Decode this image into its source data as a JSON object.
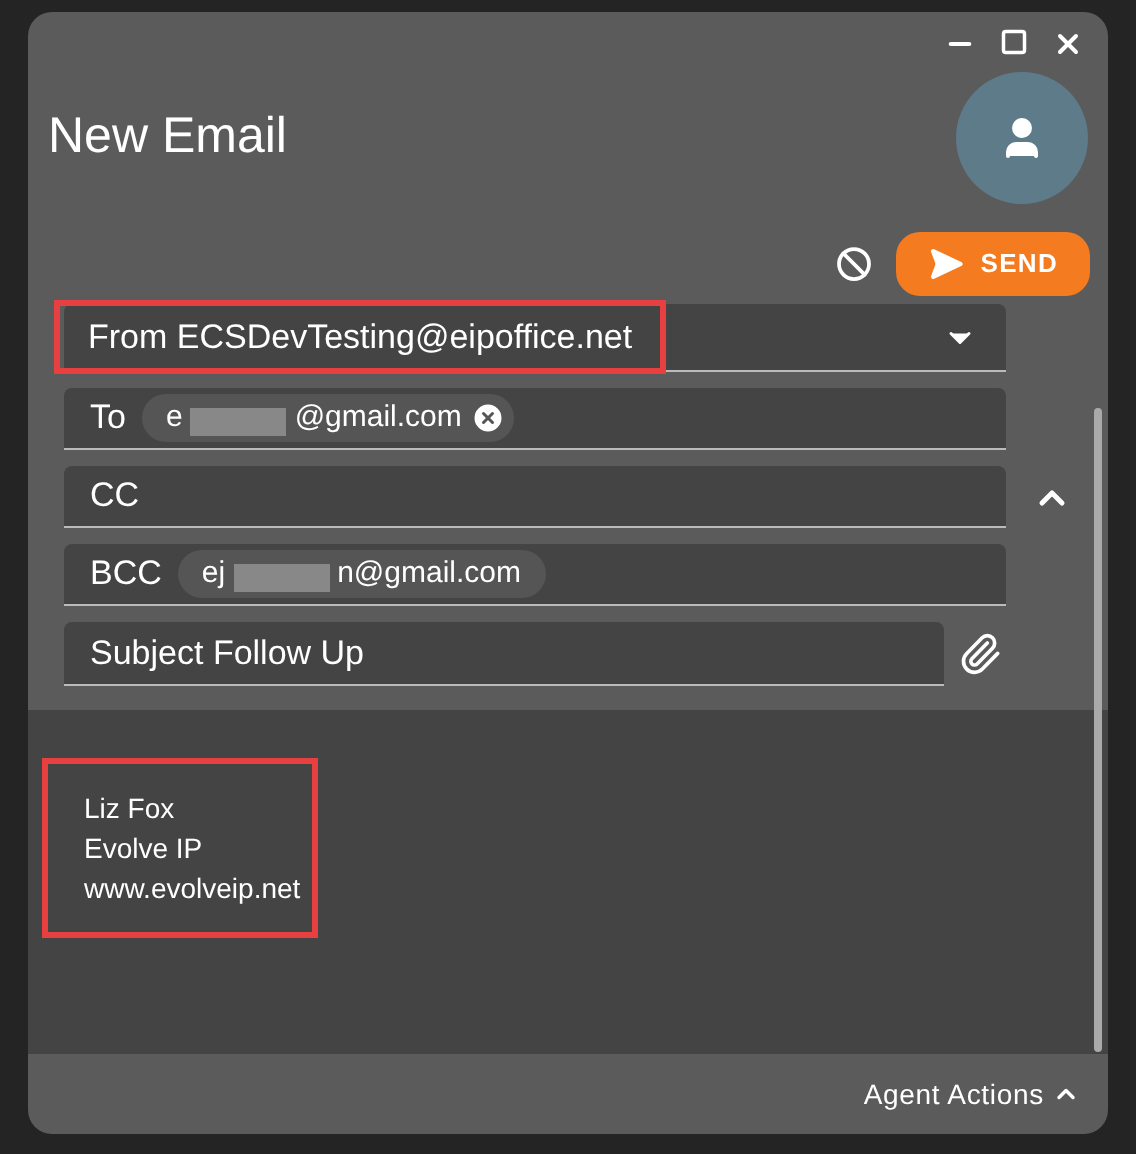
{
  "window": {
    "title": "New Email"
  },
  "actions": {
    "send": "SEND"
  },
  "from": {
    "label": "From",
    "value": "ECSDevTesting@eipoffice.net",
    "highlighted": true
  },
  "to": {
    "label": "To",
    "chips": [
      {
        "prefix": "e",
        "suffix": "@gmail.com",
        "removable": true
      }
    ]
  },
  "cc": {
    "label": "CC",
    "expanded": true
  },
  "bcc": {
    "label": "BCC",
    "chips": [
      {
        "prefix": "ej",
        "suffix": "n@gmail.com",
        "removable": false
      }
    ]
  },
  "subject": {
    "label": "Subject",
    "value": "Follow Up"
  },
  "signature": {
    "lines": [
      "Liz Fox",
      "Evolve IP",
      "www.evolveip.net"
    ],
    "highlighted": true
  },
  "footer": {
    "label": "Agent Actions"
  }
}
